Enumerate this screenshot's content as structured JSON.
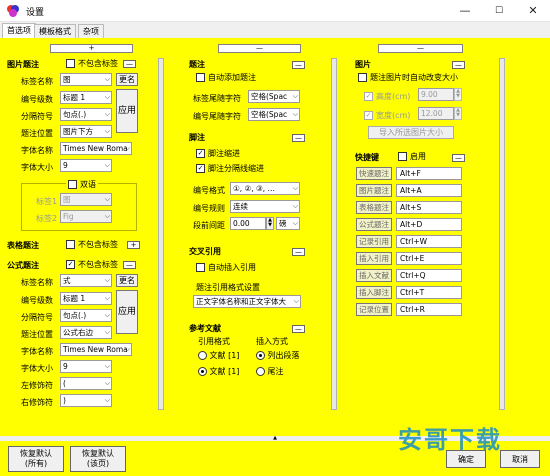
{
  "window": {
    "title": "设置",
    "min": "—",
    "max": "☐",
    "close": "✕"
  },
  "tabs": [
    "首选项",
    "模板格式",
    "杂项"
  ],
  "mini": "—",
  "left": {
    "top_bar": "+",
    "image_caption": {
      "head": "图片题注",
      "exclude_tag": "不包含标签",
      "label_name_lbl": "标签名称",
      "label_name": "图",
      "rename": "更名",
      "level_lbl": "编号级数",
      "level": "标题 1",
      "sep_lbl": "分隔符号",
      "sep": "句点(.)",
      "apply": "应用",
      "pos_lbl": "题注位置",
      "pos": "图片下方",
      "font_lbl": "字体名称",
      "font": "Times New Roma",
      "size_lbl": "字体大小",
      "size": "9"
    },
    "dual_group": {
      "title": "双语",
      "label1_lbl": "标签1",
      "label1": "图",
      "label2_lbl": "标签2",
      "label2": "Fig"
    },
    "table_caption": {
      "head": "表格题注",
      "exclude_tag": "不包含标签",
      "plus": "+"
    },
    "formula_caption": {
      "head": "公式题注",
      "exclude_tag": "不包含标签",
      "label_name_lbl": "标签名称",
      "label_name": "式",
      "rename": "更名",
      "level_lbl": "编号级数",
      "level": "标题 1",
      "sep_lbl": "分隔符号",
      "sep": "句点(.)",
      "apply": "应用",
      "pos_lbl": "题注位置",
      "pos": "公式右边",
      "font_lbl": "字体名称",
      "font": "Times New Roma",
      "size_lbl": "字体大小",
      "size": "9",
      "lmod_lbl": "左修饰符",
      "lmod": "(",
      "rmod_lbl": "右修饰符",
      "rmod": ")"
    }
  },
  "mid": {
    "caption": {
      "head": "题注",
      "auto_add": "自动添加题注",
      "tail_char_lbl": "标签尾随字符",
      "tail_char": "空格(Spac",
      "num_tail_lbl": "编号尾随字符",
      "num_tail": "空格(Spac"
    },
    "footnote": {
      "head": "脚注",
      "indent": "脚注缩进",
      "sep_indent": "脚注分隔线缩进",
      "num_fmt_lbl": "编号格式",
      "num_fmt": "①, ②, ③, …",
      "num_rule_lbl": "编号规则",
      "num_rule": "连续",
      "para_sp_lbl": "段前间距",
      "para_sp": "0.00",
      "unit": "磅"
    },
    "crossref": {
      "head": "交叉引用",
      "auto_insert": "自动插入引用",
      "ref_fmt_lbl": "题注引用格式设置",
      "ref_fmt": "正文字体名称和正文字体大"
    },
    "refs": {
      "head": "参考文献",
      "cite_fmt_lbl": "引用格式",
      "insert_lbl": "插入方式",
      "opt1": "文献 [1]",
      "opt2": "文献 [1]",
      "opt3": "列出段落",
      "opt4": "尾注"
    }
  },
  "right": {
    "image": {
      "head": "图片",
      "no_change_size": "题注图片时自动改变大小",
      "height_lbl": "高度(cm)",
      "height": "9.00",
      "width_lbl": "宽度(cm)",
      "width": "12.00",
      "import_btn": "导入所选图片大小"
    },
    "hotkeys": {
      "head": "快捷键",
      "enable": "启用",
      "rows": [
        {
          "name": "快速题注",
          "key": "Alt+F"
        },
        {
          "name": "图片题注",
          "key": "Alt+A"
        },
        {
          "name": "表格题注",
          "key": "Alt+S"
        },
        {
          "name": "公式题注",
          "key": "Alt+D"
        },
        {
          "name": "记录引用",
          "key": "Ctrl+W"
        },
        {
          "name": "插入引用",
          "key": "Ctrl+E"
        },
        {
          "name": "插入文献",
          "key": "Ctrl+Q"
        },
        {
          "name": "插入脚注",
          "key": "Ctrl+T"
        },
        {
          "name": "记录位置",
          "key": "Ctrl+R"
        }
      ]
    }
  },
  "bottom": {
    "collapse": "▲",
    "reset_all": "恢复默认\n(所有)",
    "reset_page": "恢复默认\n(该页)",
    "ok": "确定",
    "cancel": "取消",
    "watermark": "安哥下载"
  }
}
